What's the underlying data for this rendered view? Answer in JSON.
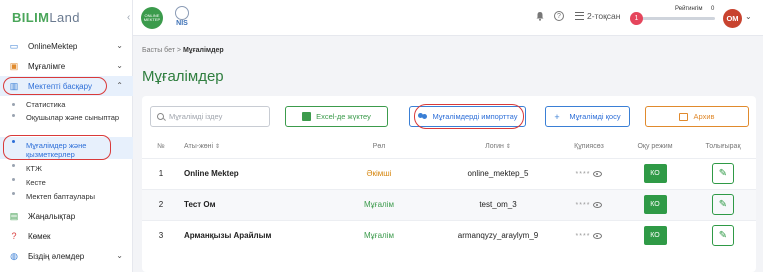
{
  "app": {
    "logo_main": "BILIM",
    "logo_land": "Land"
  },
  "sidebar": {
    "items": [
      {
        "label": "OnlineMektep"
      },
      {
        "label": "Мұғалімге"
      },
      {
        "label": "Мектепті басқару"
      },
      {
        "label": "Жаңалықтар"
      },
      {
        "label": "Көмек"
      },
      {
        "label": "Біздің әлемдер"
      }
    ],
    "sub_items": [
      {
        "label": "Статистика"
      },
      {
        "label": "Оқушылар және сыныптар"
      },
      {
        "label": "Мұғалімдер және қызметкерлер"
      },
      {
        "label": "КТЖ"
      },
      {
        "label": "Кесте"
      },
      {
        "label": "Мектеп баптаулары"
      }
    ]
  },
  "topbar": {
    "logo1_text": "ONLINE MEKTEP",
    "logo2_text": "NIS",
    "help_glyph": "?",
    "period": "2-тоқсан",
    "rating_label": "Рейтингім",
    "rating_value": "0",
    "rating_knob": "1",
    "avatar_initials": "ОМ"
  },
  "breadcrumb": {
    "home": "Басты бет",
    "separator": ">",
    "current": "Мұғалімдер"
  },
  "page": {
    "title": "Мұғалімдер"
  },
  "toolbar": {
    "search_placeholder": "Мұғалімді іздеу",
    "excel_label": "Excel-де жүктеу",
    "import_label": "Мұғалімдерді импорттау",
    "add_label": "Мұғалімді қосу",
    "archive_label": "Архив"
  },
  "table": {
    "headers": [
      "№",
      "Аты-жөні",
      "Рөл",
      "Логин",
      "Құпиясөз",
      "Оқу режим",
      "Толығырақ"
    ],
    "sort_glyph": "⇕",
    "rows": [
      {
        "num": "1",
        "name": "Online Mektep",
        "role": "Әкімші",
        "login": "online_mektep_5",
        "password": "****",
        "mode": "КО"
      },
      {
        "num": "2",
        "name": "Тест Ом",
        "role": "Мұғалім",
        "login": "test_om_3",
        "password": "****",
        "mode": "КО"
      },
      {
        "num": "3",
        "name": "Арманқызы Арайлым",
        "role": "Мұғалім",
        "login": "armanqyzy_araylym_9",
        "password": "****",
        "mode": "КО"
      }
    ]
  },
  "colors": {
    "brand_green": "#2f7e3f",
    "accent_blue": "#2e6fd8",
    "highlight_red": "#d93a3a",
    "archive_orange": "#e08a2d"
  }
}
